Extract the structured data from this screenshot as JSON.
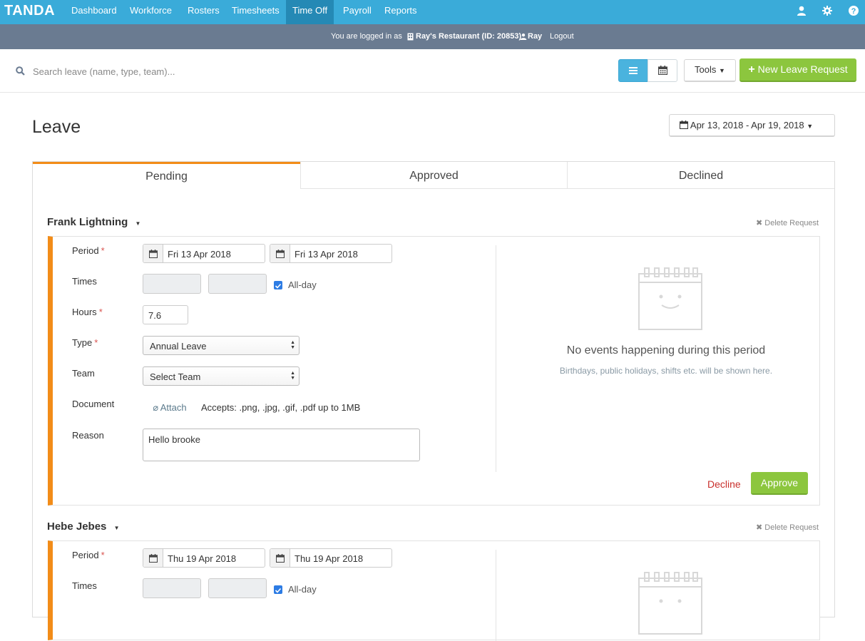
{
  "app": {
    "logo": "TANDA",
    "nav": [
      "Dashboard",
      "Workforce",
      "Rosters",
      "Timesheets",
      "Time Off",
      "Payroll",
      "Reports"
    ],
    "active_nav": "Time Off"
  },
  "login_bar": {
    "prefix": "You are logged in as",
    "org": "Ray's Restaurant (ID: 20853)",
    "user": "Ray",
    "logout": "Logout"
  },
  "toolbar": {
    "search_placeholder": "Search leave (name, type, team)...",
    "tools_label": "Tools",
    "new_leave_label": "New Leave Request"
  },
  "page": {
    "title": "Leave",
    "date_range": "Apr 13, 2018 - Apr 19, 2018"
  },
  "tabs": [
    "Pending",
    "Approved",
    "Declined"
  ],
  "labels": {
    "period": "Period",
    "times": "Times",
    "all_day": "All-day",
    "hours": "Hours",
    "type": "Type",
    "team": "Team",
    "document": "Document",
    "attach": "Attach",
    "accepts": "Accepts: .png, .jpg, .gif, .pdf up to 1MB",
    "reason": "Reason",
    "delete_request": "Delete Request",
    "no_events_title": "No events happening during this period",
    "no_events_sub": "Birthdays, public holidays, shifts etc. will be shown here.",
    "decline": "Decline",
    "approve": "Approve",
    "required_mark": "*"
  },
  "requests": [
    {
      "name": "Frank Lightning",
      "start": "Fri 13 Apr 2018",
      "end": "Fri 13 Apr 2018",
      "all_day": true,
      "hours": "7.6",
      "type": "Annual Leave",
      "team": "Select Team",
      "reason": "Hello brooke"
    },
    {
      "name": "Hebe Jebes",
      "start": "Thu 19 Apr 2018",
      "end": "Thu 19 Apr 2018",
      "all_day": true
    }
  ],
  "colors": {
    "nav_bg": "#3aabd9",
    "nav_active": "#2589b5",
    "login_bar_bg": "#6a7b91",
    "accent_orange": "#f28c18",
    "approve_green": "#8cc63e",
    "decline_red": "#c9302c"
  }
}
